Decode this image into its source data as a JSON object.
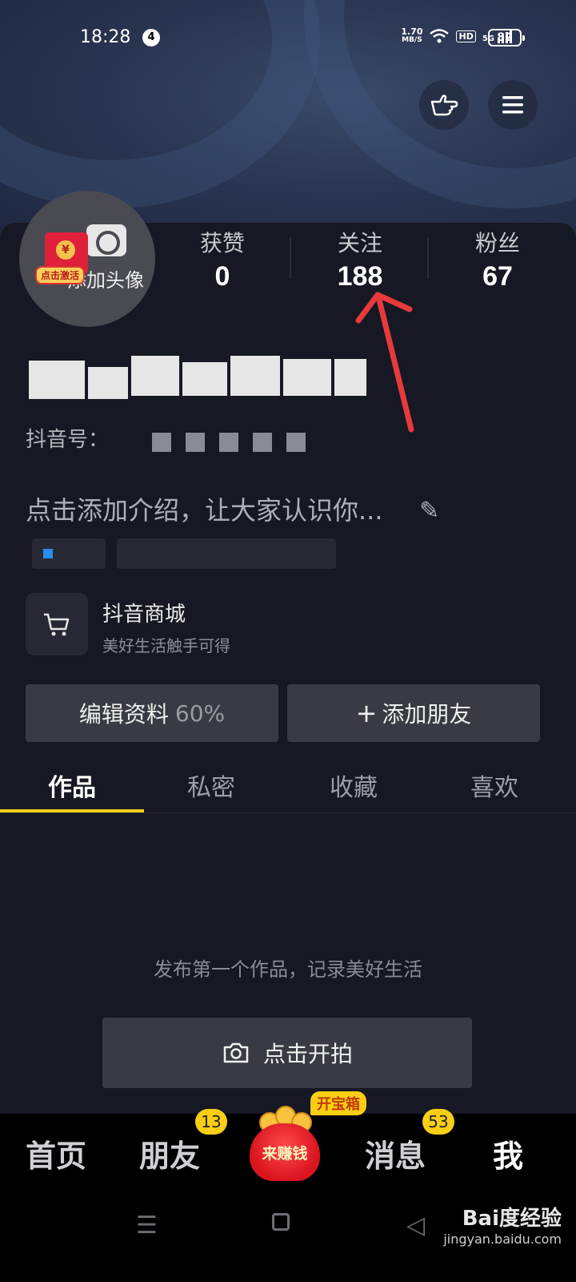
{
  "status_bar": {
    "time": "18:28",
    "notification_count": "4",
    "net_speed_value": "1.70",
    "net_speed_unit": "MB/S",
    "hd_label": "HD",
    "signal_label": "5G",
    "battery": "82"
  },
  "profile": {
    "avatar_label": "添加头像",
    "activate_label": "点击激活",
    "stats": [
      {
        "label": "获赞",
        "value": "0"
      },
      {
        "label": "关注",
        "value": "188"
      },
      {
        "label": "粉丝",
        "value": "67"
      }
    ],
    "douyin_id_prefix": "抖音号：",
    "intro_placeholder": "点击添加介绍，让大家认识你..."
  },
  "mall": {
    "title": "抖音商城",
    "subtitle": "美好生活触手可得"
  },
  "actions": {
    "edit_profile": "编辑资料",
    "edit_percent": "60%",
    "add_friend": "添加朋友",
    "add_friend_icon": "+"
  },
  "tabs": [
    "作品",
    "私密",
    "收藏",
    "喜欢"
  ],
  "empty_state": {
    "text": "发布第一个作品，记录美好生活",
    "shoot_button": "点击开拍"
  },
  "bottom_nav": {
    "home": "首页",
    "friends": "朋友",
    "friends_badge": "13",
    "earn": "来赚钱",
    "chest": "开宝箱",
    "messages": "消息",
    "messages_badge": "53",
    "me": "我"
  },
  "watermark": {
    "brand": "Bai度经验",
    "url": "jingyan.baidu.com"
  },
  "colors": {
    "background": "#161823",
    "accent": "#face15",
    "button": "#393b44",
    "annotation_arrow": "#e8393b"
  }
}
